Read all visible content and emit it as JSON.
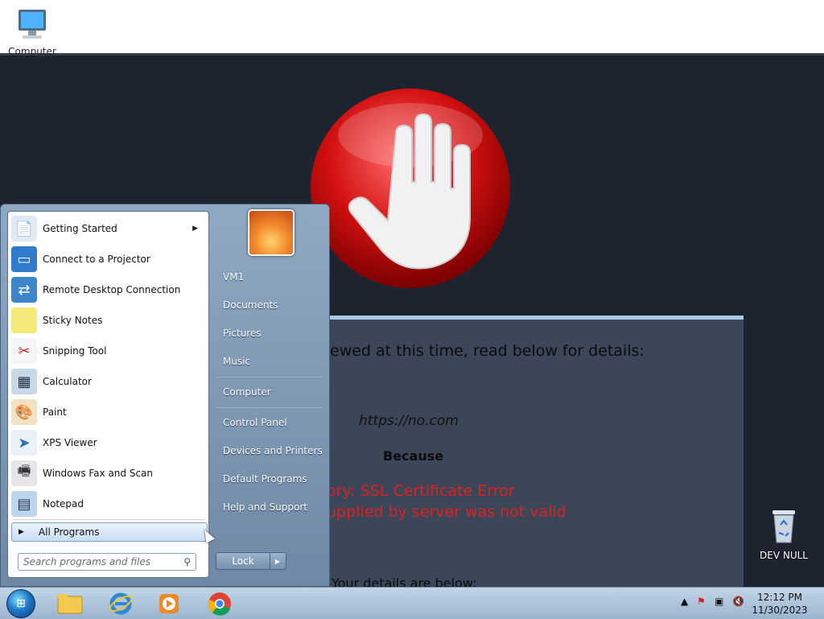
{
  "desktop": {
    "icons": [
      {
        "label": "Computer",
        "icon": "computer-icon"
      },
      {
        "label": "DEV NULL",
        "icon": "recycle-bin-icon"
      }
    ]
  },
  "block_page": {
    "line1": "ewed at this time, read below for details:",
    "url": "https://no.com",
    "because": "Because",
    "category": "ory: SSL Certificate Error",
    "reason": "upplied by server was not valid",
    "details": "Your details are below:"
  },
  "start_menu": {
    "programs": [
      {
        "label": "Getting Started",
        "icon": "getting-started-icon",
        "has_submenu": true
      },
      {
        "label": "Connect to a Projector",
        "icon": "projector-icon"
      },
      {
        "label": "Remote Desktop Connection",
        "icon": "remote-desktop-icon"
      },
      {
        "label": "Sticky Notes",
        "icon": "sticky-notes-icon"
      },
      {
        "label": "Snipping Tool",
        "icon": "snipping-tool-icon"
      },
      {
        "label": "Calculator",
        "icon": "calculator-icon"
      },
      {
        "label": "Paint",
        "icon": "paint-icon"
      },
      {
        "label": "XPS Viewer",
        "icon": "xps-viewer-icon"
      },
      {
        "label": "Windows Fax and Scan",
        "icon": "fax-scan-icon"
      },
      {
        "label": "Notepad",
        "icon": "notepad-icon"
      }
    ],
    "all_programs": "All Programs",
    "search_placeholder": "Search programs and files",
    "right_links": [
      "VM1",
      "Documents",
      "Pictures",
      "Music",
      "Computer",
      "Control Panel",
      "Devices and Printers",
      "Default Programs",
      "Help and Support"
    ],
    "lock_label": "Lock"
  },
  "taskbar": {
    "apps": [
      "explorer-icon",
      "internet-explorer-icon",
      "media-player-icon",
      "chrome-icon"
    ],
    "time": "12:12 PM",
    "date": "11/30/2023"
  },
  "colors": {
    "accent": "#1f78c8",
    "error_text": "#e02020",
    "block_red": "#d21010"
  }
}
